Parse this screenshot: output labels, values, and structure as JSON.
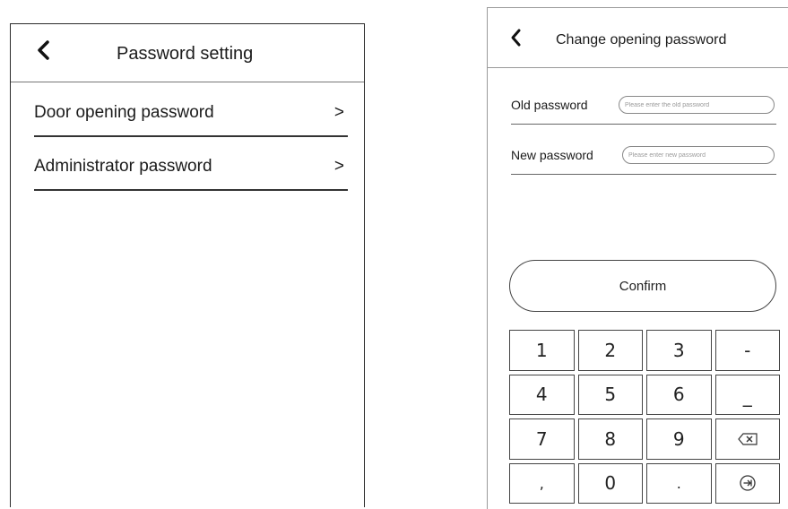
{
  "left_screen": {
    "header": {
      "title": "Password setting",
      "back_icon": "chevron-left-icon"
    },
    "menu_items": [
      {
        "label": "Door opening password",
        "chevron": ">"
      },
      {
        "label": "Administrator password",
        "chevron": ">"
      }
    ]
  },
  "right_screen": {
    "header": {
      "title": "Change opening password",
      "back_icon": "chevron-left-icon"
    },
    "old_password": {
      "label": "Old password",
      "placeholder": "Please enter the old password",
      "value": ""
    },
    "new_password": {
      "label": "New password",
      "placeholder": "Please enter new password",
      "value": ""
    },
    "confirm_label": "Confirm",
    "keypad": {
      "rows": [
        [
          "1",
          "2",
          "3",
          "-"
        ],
        [
          "4",
          "5",
          "6",
          "_"
        ],
        [
          "7",
          "8",
          "9",
          "backspace-icon"
        ],
        [
          ",",
          "0",
          ".",
          "enter-icon"
        ]
      ]
    }
  }
}
